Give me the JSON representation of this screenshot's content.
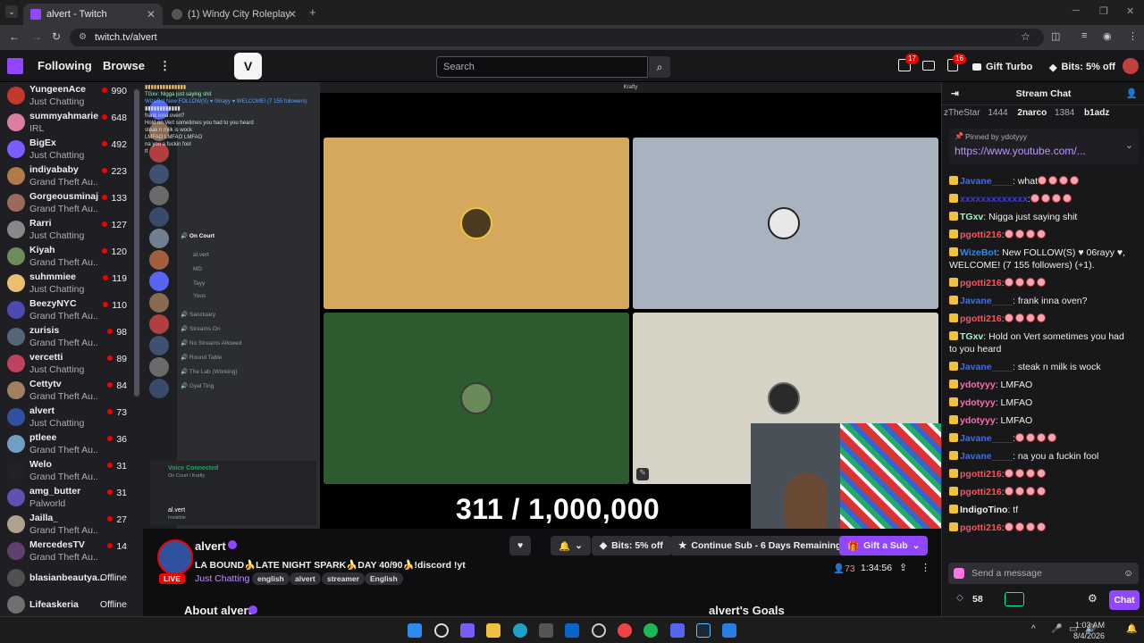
{
  "browser": {
    "tabs": [
      {
        "label": "alvert - Twitch",
        "active": true
      },
      {
        "label": "(1) Windy City Roleplay",
        "active": false
      }
    ],
    "url": "twitch.tv/alvert"
  },
  "topnav": {
    "following": "Following",
    "browse": "Browse",
    "search_placeholder": "Search",
    "gift_turbo": "Gift Turbo",
    "bits_offer": "Bits: 5% off",
    "badges": {
      "inbox": "17",
      "notifications": "16"
    }
  },
  "sidebar": {
    "channels": [
      {
        "name": "YungeenAce",
        "game": "Just Chatting",
        "viewers": "990",
        "color": "#c0392b"
      },
      {
        "name": "summyahmarie",
        "game": "IRL",
        "viewers": "648",
        "color": "#d97fa0"
      },
      {
        "name": "BigEx",
        "game": "Just Chatting",
        "viewers": "492",
        "color": "#7b5cff"
      },
      {
        "name": "indiyababy",
        "game": "Grand Theft Au...",
        "viewers": "223",
        "color": "#b07a4a"
      },
      {
        "name": "Gorgeousminaj",
        "game": "Grand Theft Au...",
        "viewers": "133",
        "color": "#9a6a5a"
      },
      {
        "name": "Rarri",
        "game": "Just Chatting",
        "viewers": "127",
        "color": "#888888"
      },
      {
        "name": "Kiyah",
        "game": "Grand Theft Au...",
        "viewers": "120",
        "color": "#6b8e5a"
      },
      {
        "name": "suhmmiee",
        "game": "Just Chatting",
        "viewers": "119",
        "color": "#e8c070"
      },
      {
        "name": "BeezyNYC",
        "game": "Grand Theft Au...",
        "viewers": "110",
        "color": "#4a4ab0"
      },
      {
        "name": "zurisis",
        "game": "Grand Theft Au...",
        "viewers": "98",
        "color": "#556677"
      },
      {
        "name": "vercetti",
        "game": "Just Chatting",
        "viewers": "89",
        "color": "#c04060"
      },
      {
        "name": "Cettytv",
        "game": "Grand Theft Au...",
        "viewers": "84",
        "color": "#a08060"
      },
      {
        "name": "alvert",
        "game": "Just Chatting",
        "viewers": "73",
        "color": "#3050a0"
      },
      {
        "name": "ptleee",
        "game": "Grand Theft Au...",
        "viewers": "36",
        "color": "#70a0c0"
      },
      {
        "name": "Welo",
        "game": "Grand Theft Au...",
        "viewers": "31",
        "color": "#222222"
      },
      {
        "name": "amg_butter",
        "game": "Palworld",
        "viewers": "31",
        "color": "#6050b0"
      },
      {
        "name": "Jailla_",
        "game": "Grand Theft Au...",
        "viewers": "27",
        "color": "#b0a090"
      },
      {
        "name": "MercedesTV",
        "game": "Grand Theft Au...",
        "viewers": "14",
        "color": "#604070"
      },
      {
        "name": "blasianbeautya...",
        "game": "",
        "viewers": "Offline",
        "color": "#505050"
      },
      {
        "name": "Lifeaskeria",
        "game": "",
        "viewers": "Offline",
        "color": "#707070"
      }
    ]
  },
  "video": {
    "window_title": "Krafty",
    "counter": "311 / 1,000,000",
    "channels": [
      "On Court",
      "Sanctuary",
      "Streams On",
      "No Streams Allowed",
      "Round Table",
      "The Lab (Working)",
      "Gyal Ting"
    ],
    "voice_users": [
      "al.vert",
      "MD",
      "Tayy",
      "Yous"
    ],
    "voice_connected": "Voice Connected",
    "voice_sub": "On Court / Krafty",
    "self_user": "al.vert",
    "self_status": "Invisible",
    "tile_colors": [
      "#d4a95e",
      "#a9b3bf",
      "#2d5a2f",
      "#d6d2c4"
    ]
  },
  "stream": {
    "channel": "alvert",
    "title": "LA BOUND🍌LATE NIGHT SPARK🍌DAY 40/90🍌!discord !yt",
    "category": "Just Chatting",
    "tags": [
      "english",
      "alvert",
      "streamer",
      "English"
    ],
    "live": "LIVE",
    "bits_offer": "Bits: 5% off",
    "continue_sub": "Continue Sub - 6 Days Remaining",
    "gift_sub": "Gift a Sub",
    "viewers": "73",
    "uptime": "1:34:56",
    "about": "About alvert",
    "goals": "alvert's Goals"
  },
  "chat": {
    "header": "Stream Chat",
    "leaders": [
      {
        "name": "zTheStar",
        "value": "1444"
      },
      {
        "name": "2narco",
        "value": "1384"
      },
      {
        "name": "b1adz",
        "value": ""
      }
    ],
    "pinned_by": "Pinned by ydotyyy",
    "pinned_link": "https://www.youtube.com/...",
    "messages": [
      {
        "user": "Javane____",
        "color": "#3a6ff0",
        "text": ": what"
      },
      {
        "user": "xxxxxxxxxxxxx",
        "color": "#3a3af0",
        "text": ":"
      },
      {
        "user": "TGxv",
        "color": "#9cf6c3",
        "text": ": Nigga just saying shit"
      },
      {
        "user": "pgotti216",
        "color": "#ff4f5a",
        "text": ":"
      },
      {
        "user": "WizeBot",
        "color": "#1e90ff",
        "text": ": New FOLLOW(S) ♥ 06rayy ♥, WELCOME! (7 155 followers) (+1)."
      },
      {
        "user": "pgotti216",
        "color": "#ff4f5a",
        "text": ":"
      },
      {
        "user": "Javane____",
        "color": "#3a6ff0",
        "text": ": frank inna oven?"
      },
      {
        "user": "pgotti216",
        "color": "#ff4f5a",
        "text": ":"
      },
      {
        "user": "TGxv",
        "color": "#9cf6c3",
        "text": ": Hold on Vert sometimes you had to you heard"
      },
      {
        "user": "Javane____",
        "color": "#3a6ff0",
        "text": ": steak n milk is wock"
      },
      {
        "user": "ydotyyy",
        "color": "#ff69b4",
        "text": ": LMFAO"
      },
      {
        "user": "ydotyyy",
        "color": "#ff69b4",
        "text": ": LMFAO"
      },
      {
        "user": "ydotyyy",
        "color": "#ff69b4",
        "text": ": LMFAO"
      },
      {
        "user": "Javane____",
        "color": "#3a6ff0",
        "text": ":"
      },
      {
        "user": "Javane____",
        "color": "#3a6ff0",
        "text": ": na you a fuckin fool"
      },
      {
        "user": "pgotti216",
        "color": "#ff4f5a",
        "text": ":"
      },
      {
        "user": "pgotti216",
        "color": "#ff4f5a",
        "text": ":"
      },
      {
        "user": "IndigoTino",
        "color": "#efeff1",
        "text": ": tf"
      },
      {
        "user": "pgotti216",
        "color": "#ff4f5a",
        "text": ":"
      }
    ],
    "input_placeholder": "Send a message",
    "points": "58",
    "chat_button": "Chat"
  },
  "taskbar": {
    "time": "1:03 AM",
    "date": "8/4/2026"
  }
}
